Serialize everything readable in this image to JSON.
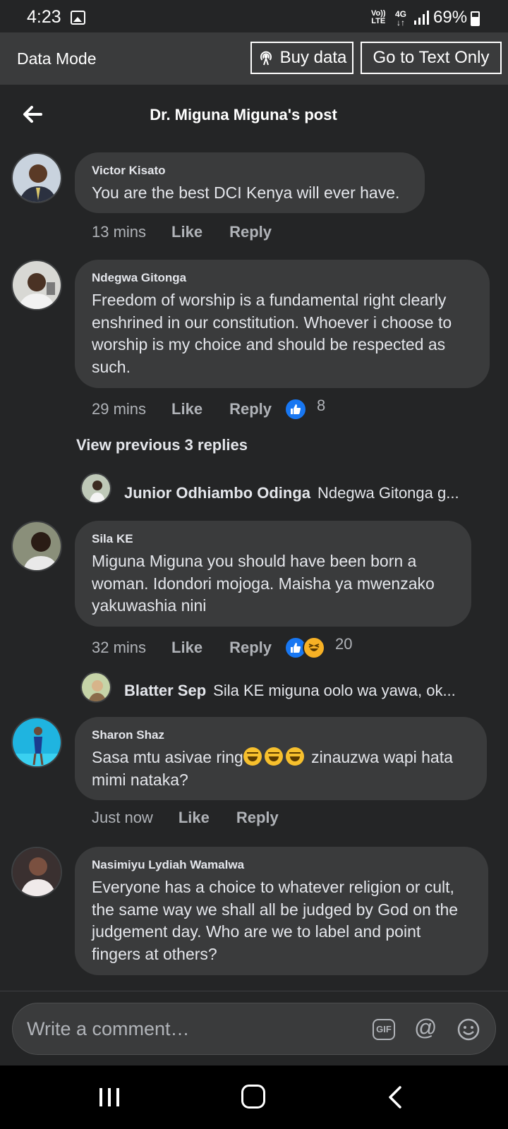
{
  "status": {
    "time": "4:23",
    "lte": "Vo)) LTE",
    "network": "4G",
    "battery": "69%"
  },
  "data_mode": {
    "label": "Data Mode",
    "buy_label": "Buy data",
    "text_only_label": "Go to Text Only"
  },
  "header": {
    "title": "Dr. Miguna Miguna's post"
  },
  "comments": [
    {
      "name": "Victor Kisato",
      "text": "You are the best DCI Kenya will ever have.",
      "time": "13 mins",
      "like": "Like",
      "reply": "Reply"
    },
    {
      "name": "Ndegwa Gitonga",
      "text": "Freedom of worship is a fundamental right clearly enshrined in our constitution. Whoever i choose to worship is my choice and should be respected as such.",
      "time": "29 mins",
      "like": "Like",
      "reply": "Reply",
      "reactions": "8"
    },
    {
      "name": "Sila KE",
      "text": "Miguna Miguna you should have been born a woman. Idondori mojoga. Maisha ya mwenzako yakuwashia nini",
      "time": "32 mins",
      "like": "Like",
      "reply": "Reply",
      "reactions": "20"
    },
    {
      "name": "Sharon Shaz",
      "text_before": "Sasa mtu asivae ring",
      "text_after": " zinauzwa wapi hata mimi nataka?",
      "time": "Just now",
      "like": "Like",
      "reply": "Reply"
    },
    {
      "name": "Nasimiyu Lydiah Wamalwa",
      "text": "Everyone has a choice to whatever religion or cult, the same way we shall all be judged by God on the judgement day. Who are we to label and point fingers at others?"
    }
  ],
  "view_previous": "View previous 3 replies",
  "replies": [
    {
      "name": "Junior Odhiambo Odinga",
      "snippet": "Ndegwa Gitonga g..."
    },
    {
      "name": "Blatter Sep",
      "snippet": "Sila KE miguna oolo wa yawa, ok..."
    }
  ],
  "composer": {
    "placeholder": "Write a comment…",
    "gif_label": "GIF",
    "at_label": "@"
  }
}
